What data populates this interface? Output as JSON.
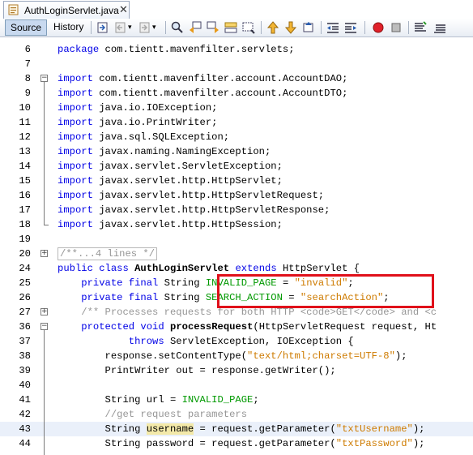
{
  "tab": {
    "filename": "AuthLoginServlet.java",
    "close_glyph": "✕"
  },
  "toolbar": {
    "source_label": "Source",
    "history_label": "History",
    "icons": [
      "last-edit-icon",
      "back-icon",
      "forward-icon",
      "find-icon",
      "find-previous-icon",
      "find-next-icon",
      "find-selection-icon",
      "toggle-highlight-icon",
      "toggle-rect-selection-icon",
      "previous-bookmark-icon",
      "next-bookmark-icon",
      "toggle-bookmark-icon",
      "shift-left-icon",
      "shift-right-icon",
      "start-macro-icon",
      "stop-macro-icon",
      "comment-icon",
      "uncomment-icon"
    ]
  },
  "colors": {
    "keyword": "#0000e6",
    "field": "#009900",
    "string": "#ce7b00",
    "comment": "#969696",
    "highlight_box": "#e0101a"
  },
  "lines": [
    {
      "n": "6",
      "tokens": [
        [
          "kw",
          "package"
        ],
        [
          "t",
          " com.tientt.mavenfilter.servlets;"
        ]
      ]
    },
    {
      "n": "7",
      "tokens": []
    },
    {
      "n": "8",
      "tokens": [
        [
          "kw",
          "import"
        ],
        [
          "t",
          " com.tientt.mavenfilter.account.AccountDAO;"
        ]
      ]
    },
    {
      "n": "9",
      "tokens": [
        [
          "kw",
          "import"
        ],
        [
          "t",
          " com.tientt.mavenfilter.account.AccountDTO;"
        ]
      ]
    },
    {
      "n": "10",
      "tokens": [
        [
          "kw",
          "import"
        ],
        [
          "t",
          " java.io.IOException;"
        ]
      ]
    },
    {
      "n": "11",
      "tokens": [
        [
          "kw",
          "import"
        ],
        [
          "t",
          " java.io.PrintWriter;"
        ]
      ]
    },
    {
      "n": "12",
      "tokens": [
        [
          "kw",
          "import"
        ],
        [
          "t",
          " java.sql.SQLException;"
        ]
      ]
    },
    {
      "n": "13",
      "tokens": [
        [
          "kw",
          "import"
        ],
        [
          "t",
          " javax.naming.NamingException;"
        ]
      ]
    },
    {
      "n": "14",
      "tokens": [
        [
          "kw",
          "import"
        ],
        [
          "t",
          " javax.servlet.ServletException;"
        ]
      ]
    },
    {
      "n": "15",
      "tokens": [
        [
          "kw",
          "import"
        ],
        [
          "t",
          " javax.servlet.http.HttpServlet;"
        ]
      ]
    },
    {
      "n": "16",
      "tokens": [
        [
          "kw",
          "import"
        ],
        [
          "t",
          " javax.servlet.http.HttpServletRequest;"
        ]
      ]
    },
    {
      "n": "17",
      "tokens": [
        [
          "kw",
          "import"
        ],
        [
          "t",
          " javax.servlet.http.HttpServletResponse;"
        ]
      ]
    },
    {
      "n": "18",
      "tokens": [
        [
          "kw",
          "import"
        ],
        [
          "t",
          " javax.servlet.http.HttpSession;"
        ]
      ]
    },
    {
      "n": "19",
      "tokens": []
    },
    {
      "n": "20",
      "tokens": [
        [
          "cmt",
          "/**...4 lines */"
        ]
      ]
    },
    {
      "n": "24",
      "tokens": [
        [
          "kw",
          "public class"
        ],
        [
          "t",
          " "
        ],
        [
          "fn",
          "AuthLoginServlet"
        ],
        [
          "t",
          " "
        ],
        [
          "kw",
          "extends"
        ],
        [
          "t",
          " HttpServlet {"
        ]
      ]
    },
    {
      "n": "25",
      "tokens": [
        [
          "t",
          "    "
        ],
        [
          "kw",
          "private final"
        ],
        [
          "t",
          " String "
        ],
        [
          "fld",
          "INVALID_PAGE"
        ],
        [
          "t",
          " = "
        ],
        [
          "str",
          "\"invalid\""
        ],
        [
          "t",
          ";"
        ]
      ]
    },
    {
      "n": "26",
      "tokens": [
        [
          "t",
          "    "
        ],
        [
          "kw",
          "private final"
        ],
        [
          "t",
          " String "
        ],
        [
          "fld",
          "SEARCH_ACTION"
        ],
        [
          "t",
          " = "
        ],
        [
          "str",
          "\"searchAction\""
        ],
        [
          "t",
          ";"
        ]
      ]
    },
    {
      "n": "27",
      "tokens": [
        [
          "t",
          "    "
        ],
        [
          "cmt",
          "/** Processes requests for both HTTP <code>GET</code> and <c"
        ]
      ]
    },
    {
      "n": "36",
      "tokens": [
        [
          "t",
          "    "
        ],
        [
          "kw",
          "protected void"
        ],
        [
          "t",
          " "
        ],
        [
          "fn",
          "processRequest"
        ],
        [
          "t",
          "(HttpServletRequest request, Ht"
        ]
      ]
    },
    {
      "n": "37",
      "tokens": [
        [
          "t",
          "            "
        ],
        [
          "kw",
          "throws"
        ],
        [
          "t",
          " ServletException, IOException {"
        ]
      ]
    },
    {
      "n": "38",
      "tokens": [
        [
          "t",
          "        response.setContentType("
        ],
        [
          "str",
          "\"text/html;charset=UTF-8\""
        ],
        [
          "t",
          ");"
        ]
      ]
    },
    {
      "n": "39",
      "tokens": [
        [
          "t",
          "        PrintWriter out = response.getWriter();"
        ]
      ]
    },
    {
      "n": "40",
      "tokens": []
    },
    {
      "n": "41",
      "tokens": [
        [
          "t",
          "        String url = "
        ],
        [
          "fld",
          "INVALID_PAGE"
        ],
        [
          "t",
          ";"
        ]
      ]
    },
    {
      "n": "42",
      "tokens": [
        [
          "t",
          "        "
        ],
        [
          "cmt",
          "//get request parameters"
        ]
      ]
    },
    {
      "n": "43",
      "tokens": [
        [
          "t",
          "        String "
        ],
        [
          "hl",
          "username"
        ],
        [
          "t",
          " = request.getParameter("
        ],
        [
          "str",
          "\"txtUsername\""
        ],
        [
          "t",
          ");"
        ]
      ]
    },
    {
      "n": "44",
      "tokens": [
        [
          "t",
          "        String password = request.getParameter("
        ],
        [
          "str",
          "\"txtPassword\""
        ],
        [
          "t",
          ");"
        ]
      ]
    }
  ]
}
